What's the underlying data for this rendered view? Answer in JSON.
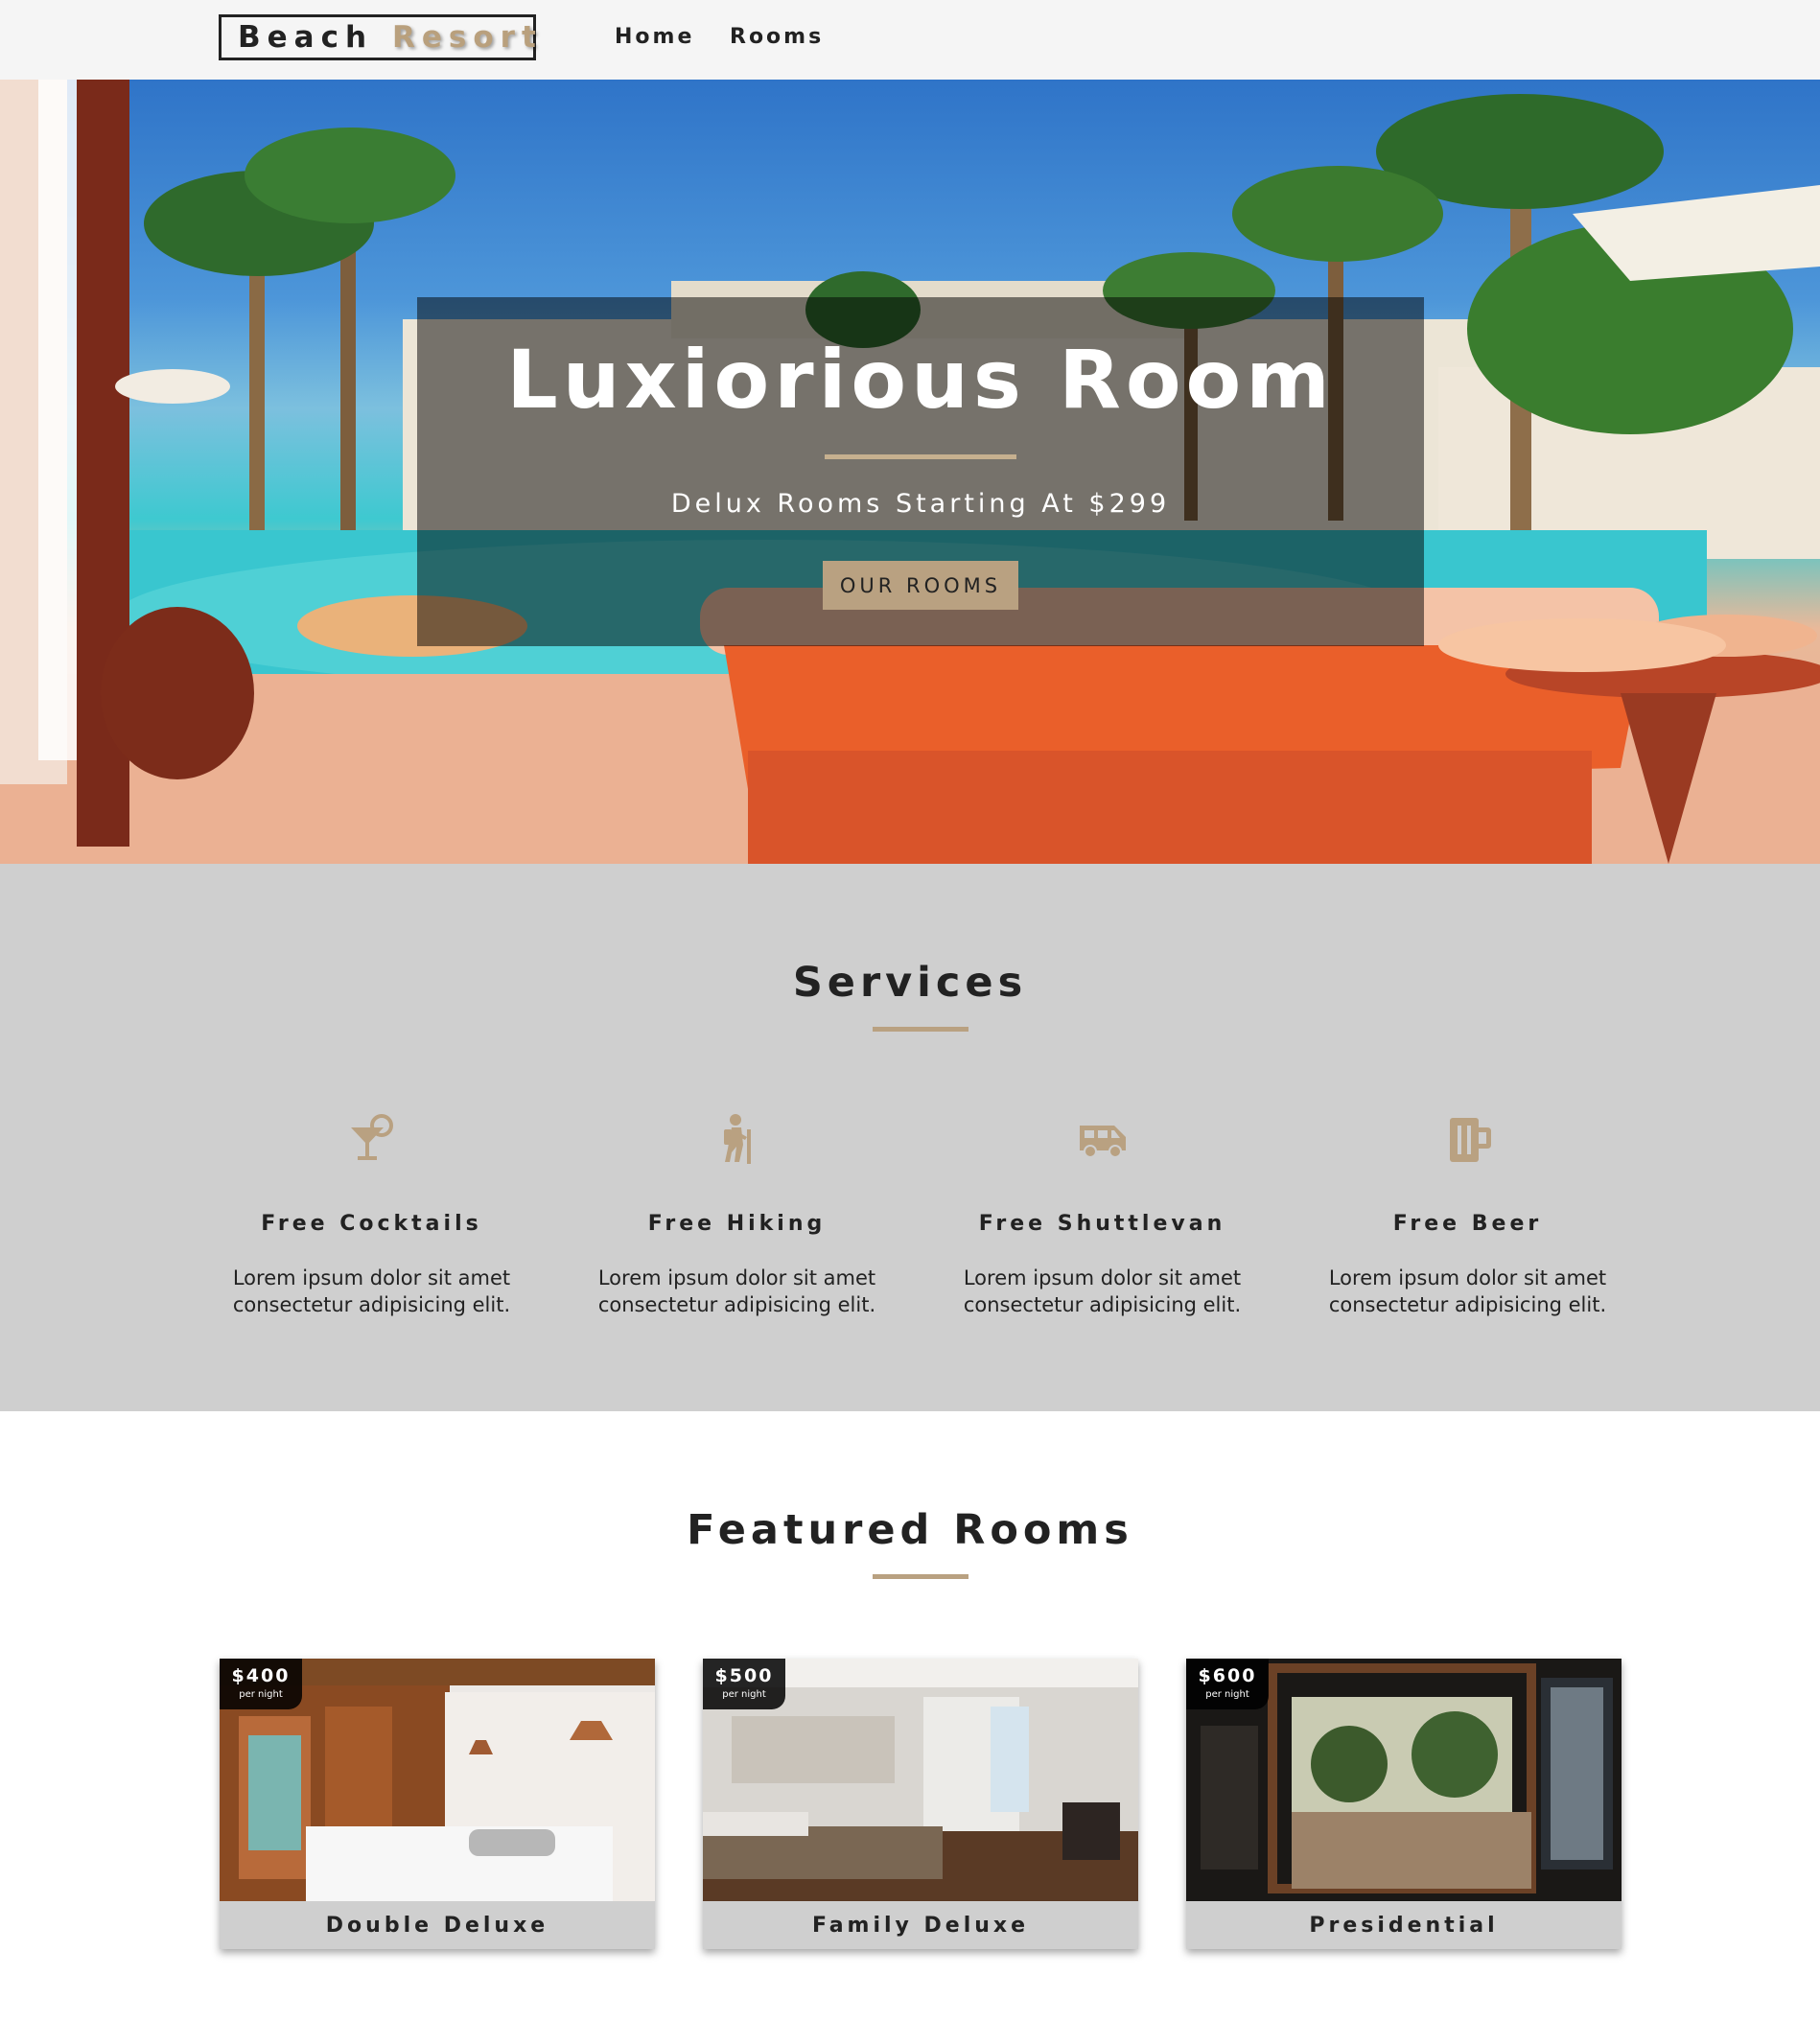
{
  "nav": {
    "logo_word1": "Beach",
    "logo_word2": "Resort",
    "links": [
      "Home",
      "Rooms"
    ]
  },
  "hero": {
    "title": "Luxiorious Room",
    "subtitle": "Delux Rooms Starting At $299",
    "button": "OUR ROOMS"
  },
  "services": {
    "title": "Services",
    "items": [
      {
        "icon": "cocktail-icon",
        "title": "Free Cocktails",
        "text": "Lorem ipsum dolor sit amet consectetur adipisicing elit."
      },
      {
        "icon": "hiking-icon",
        "title": "Free Hiking",
        "text": "Lorem ipsum dolor sit amet consectetur adipisicing elit."
      },
      {
        "icon": "shuttle-van-icon",
        "title": "Free Shuttlevan",
        "text": "Lorem ipsum dolor sit amet consectetur adipisicing elit."
      },
      {
        "icon": "beer-icon",
        "title": "Free Beer",
        "text": "Lorem ipsum dolor sit amet consectetur adipisicing elit."
      }
    ]
  },
  "featured": {
    "title": "Featured Rooms",
    "rooms": [
      {
        "price": "$400",
        "per": "per night",
        "name": "Double Deluxe"
      },
      {
        "price": "$500",
        "per": "per night",
        "name": "Family Deluxe"
      },
      {
        "price": "$600",
        "per": "per night",
        "name": "Presidential"
      }
    ]
  },
  "colors": {
    "accent": "#b9a181",
    "nav_bg": "#f5f5f5",
    "services_bg": "#cfcfcf",
    "text": "#222222"
  }
}
